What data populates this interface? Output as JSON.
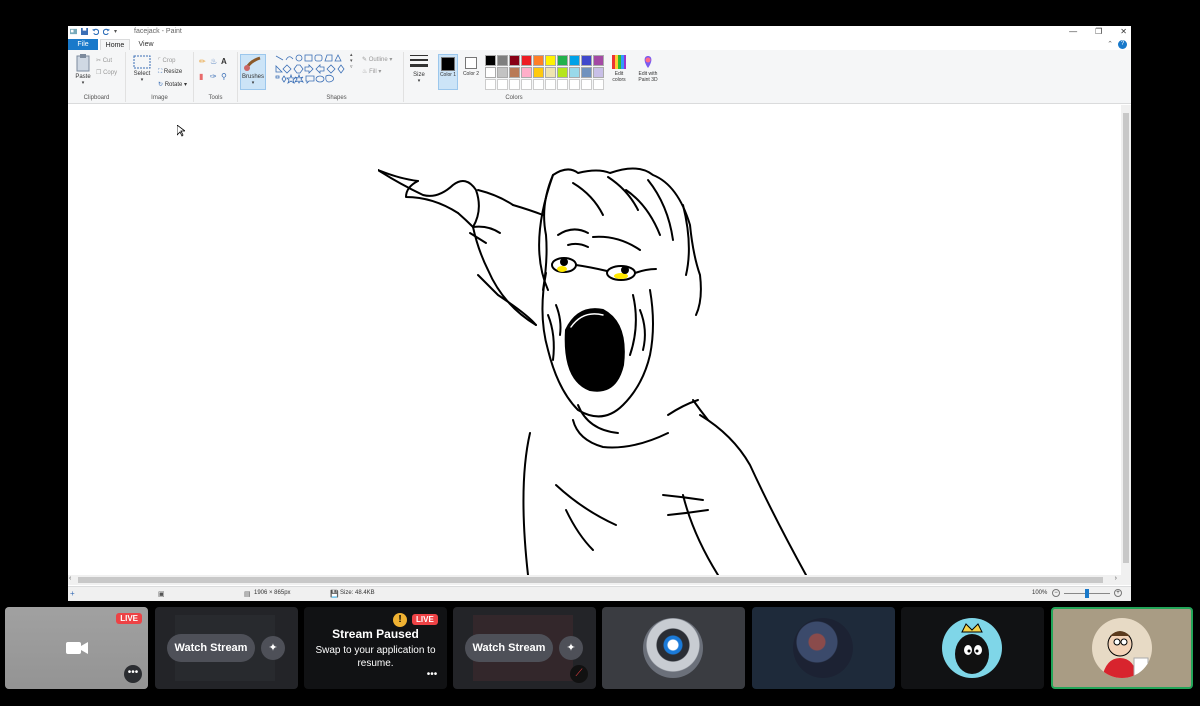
{
  "paint": {
    "title": "facejack - Paint",
    "tabs": [
      "File",
      "Home",
      "View"
    ],
    "help": "?",
    "window_controls": [
      "—",
      "❐",
      "✕"
    ],
    "ribbon": {
      "clipboard": {
        "paste": "Paste",
        "cut": "Cut",
        "copy": "Copy",
        "label": "Clipboard"
      },
      "image": {
        "select": "Select",
        "crop": "Crop",
        "resize": "Resize",
        "rotate": "Rotate",
        "label": "Image"
      },
      "tools": {
        "label": "Tools"
      },
      "brushes": {
        "label": "Brushes"
      },
      "shapes": {
        "outline": "Outline",
        "fill": "Fill",
        "label": "Shapes"
      },
      "size": {
        "label": "Size"
      },
      "colors": {
        "color1": "Color 1",
        "color2": "Color 2",
        "edit_colors": "Edit colors",
        "edit_paint3d": "Edit with Paint 3D",
        "label": "Colors",
        "palette_row1": [
          "#000000",
          "#7f7f7f",
          "#880015",
          "#ed1c24",
          "#ff7f27",
          "#fff200",
          "#22b14c",
          "#00a2e8",
          "#3f48cc",
          "#a349a4"
        ],
        "palette_row2": [
          "#ffffff",
          "#c3c3c3",
          "#b97a57",
          "#ffaec9",
          "#ffc90e",
          "#efe4b0",
          "#b5e61d",
          "#99d9ea",
          "#7092be",
          "#c8bfe7"
        ],
        "color1_value": "#000000",
        "color2_value": "#ffffff"
      }
    },
    "status": {
      "dimensions": "1906 × 865px",
      "size": "Size: 48.4KB",
      "zoom": "100%",
      "zoom_level": 1.0
    }
  },
  "tiles": [
    {
      "type": "camera",
      "badge": "LIVE",
      "more": "•••"
    },
    {
      "type": "stream",
      "button": "Watch Stream"
    },
    {
      "type": "paused",
      "badge": "LIVE",
      "heading": "Stream Paused",
      "text": "Swap to your application to resume.",
      "more": "•••"
    },
    {
      "type": "stream",
      "button": "Watch Stream"
    },
    {
      "type": "avatar",
      "icon": "robot-avatar"
    },
    {
      "type": "avatar",
      "icon": "gamer-avatar"
    },
    {
      "type": "avatar",
      "icon": "cartoon-king-avatar"
    },
    {
      "type": "avatar",
      "icon": "peter-avatar",
      "speaking": true
    }
  ],
  "colors": {
    "accent_blue": "#1979ca",
    "live_red": "#ed4245",
    "speaking_green": "#23a559"
  }
}
